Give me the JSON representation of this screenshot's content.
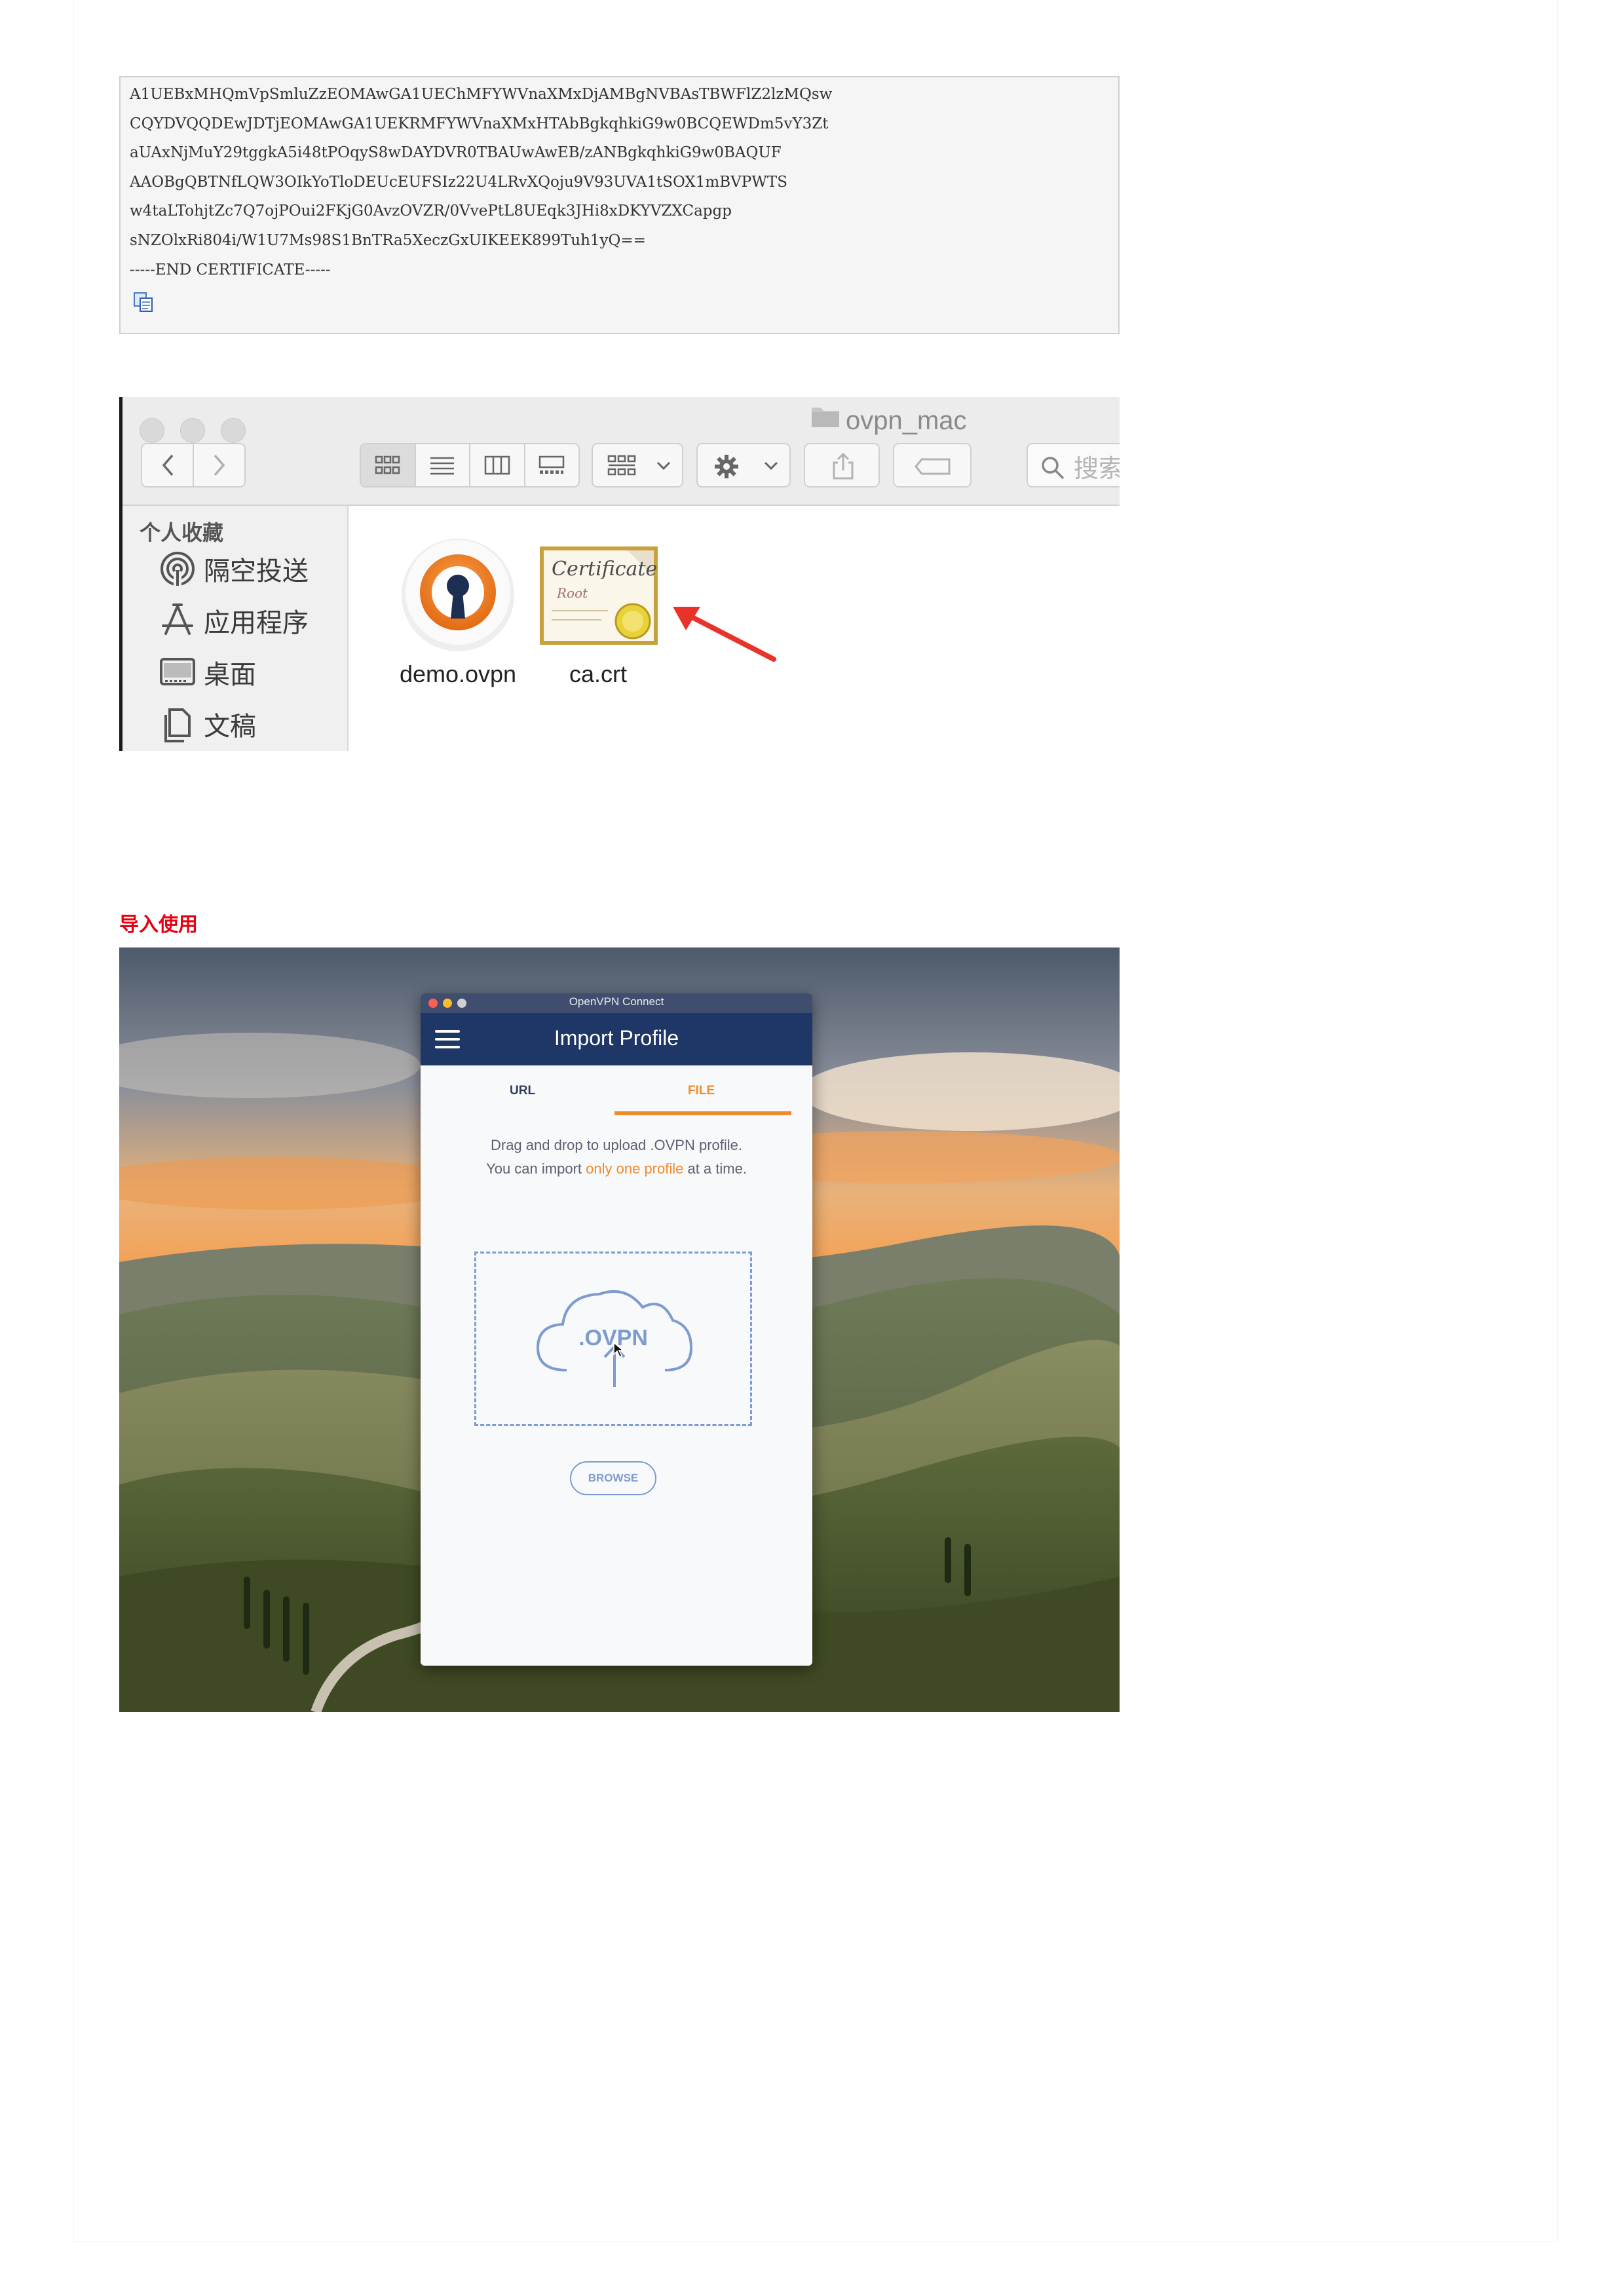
{
  "code_block": {
    "lines": [
      "A1UEBxMHQmVpSmluZzEOMAwGA1UEChMFYWVnaXMxDjAMBgNVBAsTBWFlZ2lzMQsw",
      "CQYDVQQDEwJDTjEOMAwGA1UEKRMFYWVnaXMxHTAbBgkqhkiG9w0BCQEWDm5vY3Zt",
      "aUAxNjMuY29tggkA5i48tPOqyS8wDAYDVR0TBAUwAwEB/zANBgkqhkiG9w0BAQUF",
      "AAOBgQBTNfLQW3OIkYoTloDEUcEUFSIz22U4LRvXQoju9V93UVA1tSOX1mBVPWTS",
      "w4taLTohjtZc7Q7ojPOui2FKjG0AvzOVZR/0VvePtL8UEqk3JHi8xDKYVZXCapgp",
      "sNZOlxRi804i/W1U7Ms98S1BnTRa5XeczGxUIKEEK899Tuh1yQ==",
      "-----END CERTIFICATE-----"
    ],
    "copy_icon": "copy-icon"
  },
  "finder": {
    "window_title": "ovpn_mac",
    "search_placeholder": "搜索",
    "sidebar": {
      "heading": "个人收藏",
      "items": [
        {
          "label": "隔空投送",
          "icon": "airdrop-icon"
        },
        {
          "label": "应用程序",
          "icon": "applications-icon"
        },
        {
          "label": "桌面",
          "icon": "desktop-icon"
        },
        {
          "label": "文稿",
          "icon": "documents-icon"
        }
      ]
    },
    "files": [
      {
        "name": "demo.ovpn",
        "icon": "openvpn-file-icon"
      },
      {
        "name": "ca.crt",
        "icon": "certificate-icon"
      }
    ],
    "arrow_color": "#e8332a"
  },
  "section_heading": "导入使用",
  "openvpn": {
    "window_title": "OpenVPN Connect",
    "heading": "Import Profile",
    "tabs": [
      {
        "label": "URL",
        "active": false
      },
      {
        "label": "FILE",
        "active": true
      }
    ],
    "instructions_line1": "Drag and drop to upload .OVPN profile.",
    "instructions_line2_before": "You can import ",
    "instructions_highlight": "only one profile",
    "instructions_line2_after": " at a time.",
    "drop_label": ".OVPN",
    "browse_button": "BROWSE",
    "accent_color": "#f08a2b",
    "header_color": "#1f3766"
  }
}
